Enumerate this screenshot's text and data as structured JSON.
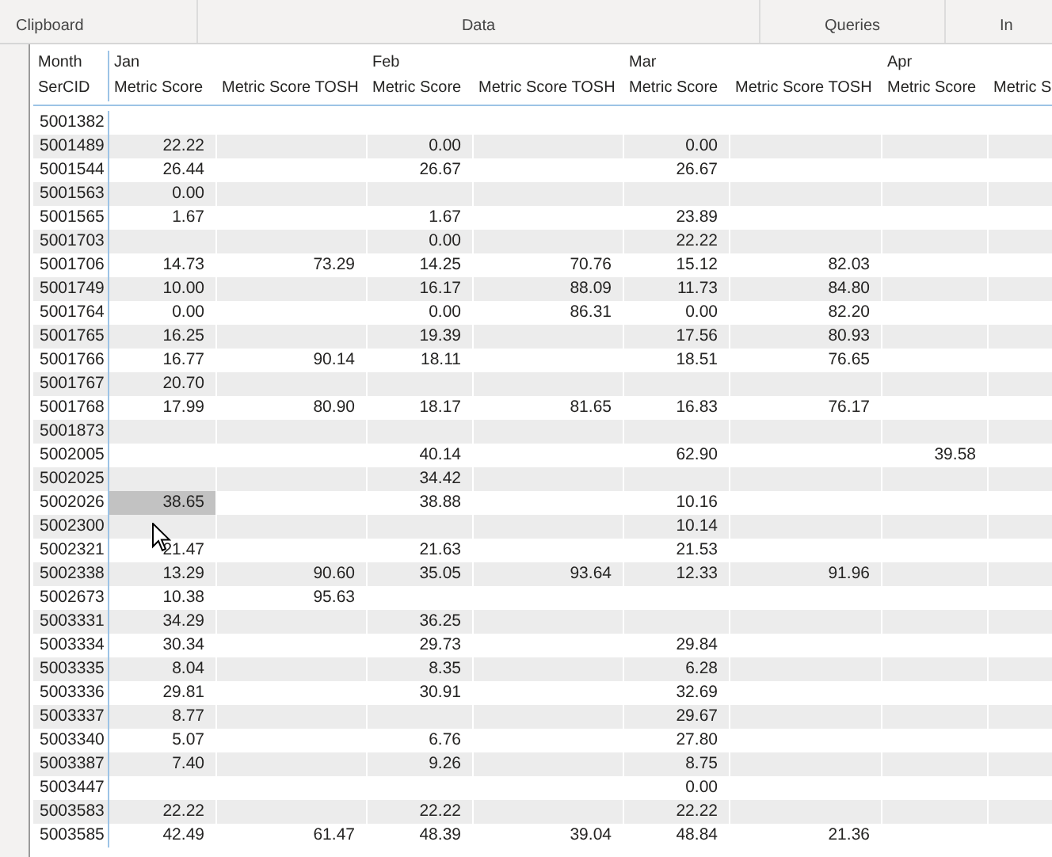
{
  "ribbon": {
    "groups": [
      {
        "label": "Clipboard"
      },
      {
        "label": "Data"
      },
      {
        "label": "Queries"
      },
      {
        "label": "In"
      }
    ]
  },
  "table": {
    "columns": [
      {
        "month": "Month",
        "label": "SerCID"
      },
      {
        "month": "Jan",
        "label": "Metric Score"
      },
      {
        "label": "Metric Score TOSH"
      },
      {
        "month": "Feb",
        "label": "Metric Score"
      },
      {
        "label": "Metric Score TOSH"
      },
      {
        "month": "Mar",
        "label": "Metric Score"
      },
      {
        "label": "Metric Score TOSH"
      },
      {
        "month": "Apr",
        "label": "Metric Score"
      },
      {
        "label": "Metric S"
      }
    ],
    "rows": [
      {
        "cells": [
          {
            "value": "5001382",
            "selected": false
          }
        ]
      },
      {
        "cells": [
          {
            "value": "5001489",
            "selected": false
          },
          {
            "value": "22.22",
            "selected": false
          },
          {
            "selected": false
          },
          {
            "value": "0.00",
            "selected": false
          },
          {
            "selected": false
          },
          {
            "value": "0.00",
            "selected": false
          }
        ]
      },
      {
        "cells": [
          {
            "value": "5001544",
            "selected": false
          },
          {
            "value": "26.44",
            "selected": false
          },
          {
            "selected": false
          },
          {
            "value": "26.67",
            "selected": false
          },
          {
            "selected": false
          },
          {
            "value": "26.67",
            "selected": false
          }
        ]
      },
      {
        "cells": [
          {
            "value": "5001563",
            "selected": false
          },
          {
            "value": "0.00",
            "selected": false
          }
        ]
      },
      {
        "cells": [
          {
            "value": "5001565",
            "selected": false
          },
          {
            "value": "1.67",
            "selected": false
          },
          {
            "selected": false
          },
          {
            "value": "1.67",
            "selected": false
          },
          {
            "selected": false
          },
          {
            "value": "23.89",
            "selected": false
          }
        ]
      },
      {
        "cells": [
          {
            "value": "5001703",
            "selected": false
          },
          {
            "selected": false
          },
          {
            "selected": false
          },
          {
            "value": "0.00",
            "selected": false
          },
          {
            "selected": false
          },
          {
            "value": "22.22",
            "selected": false
          }
        ]
      },
      {
        "cells": [
          {
            "value": "5001706",
            "selected": false
          },
          {
            "value": "14.73",
            "selected": false
          },
          {
            "value": "73.29",
            "selected": false
          },
          {
            "value": "14.25",
            "selected": false
          },
          {
            "value": "70.76",
            "selected": false
          },
          {
            "value": "15.12",
            "selected": false
          },
          {
            "value": "82.03",
            "selected": false
          }
        ]
      },
      {
        "cells": [
          {
            "value": "5001749",
            "selected": false
          },
          {
            "value": "10.00",
            "selected": false
          },
          {
            "selected": false
          },
          {
            "value": "16.17",
            "selected": false
          },
          {
            "value": "88.09",
            "selected": false
          },
          {
            "value": "11.73",
            "selected": false
          },
          {
            "value": "84.80",
            "selected": false
          }
        ]
      },
      {
        "cells": [
          {
            "value": "5001764",
            "selected": false
          },
          {
            "value": "0.00",
            "selected": false
          },
          {
            "selected": false
          },
          {
            "value": "0.00",
            "selected": false
          },
          {
            "value": "86.31",
            "selected": false
          },
          {
            "value": "0.00",
            "selected": false
          },
          {
            "value": "82.20",
            "selected": false
          }
        ]
      },
      {
        "cells": [
          {
            "value": "5001765",
            "selected": false
          },
          {
            "value": "16.25",
            "selected": false
          },
          {
            "selected": false
          },
          {
            "value": "19.39",
            "selected": false
          },
          {
            "selected": false
          },
          {
            "value": "17.56",
            "selected": false
          },
          {
            "value": "80.93",
            "selected": false
          }
        ]
      },
      {
        "cells": [
          {
            "value": "5001766",
            "selected": false
          },
          {
            "value": "16.77",
            "selected": false
          },
          {
            "value": "90.14",
            "selected": false
          },
          {
            "value": "18.11",
            "selected": false
          },
          {
            "selected": false
          },
          {
            "value": "18.51",
            "selected": false
          },
          {
            "value": "76.65",
            "selected": false
          }
        ]
      },
      {
        "cells": [
          {
            "value": "5001767",
            "selected": false
          },
          {
            "value": "20.70",
            "selected": false
          }
        ]
      },
      {
        "cells": [
          {
            "value": "5001768",
            "selected": false
          },
          {
            "value": "17.99",
            "selected": false
          },
          {
            "value": "80.90",
            "selected": false
          },
          {
            "value": "18.17",
            "selected": false
          },
          {
            "value": "81.65",
            "selected": false
          },
          {
            "value": "16.83",
            "selected": false
          },
          {
            "value": "76.17",
            "selected": false
          }
        ]
      },
      {
        "cells": [
          {
            "value": "5001873",
            "selected": false
          }
        ]
      },
      {
        "cells": [
          {
            "value": "5002005",
            "selected": false
          },
          {
            "selected": false
          },
          {
            "selected": false
          },
          {
            "value": "40.14",
            "selected": false
          },
          {
            "selected": false
          },
          {
            "value": "62.90",
            "selected": false
          },
          {
            "selected": false
          },
          {
            "value": "39.58",
            "selected": false
          }
        ]
      },
      {
        "cells": [
          {
            "value": "5002025",
            "selected": false
          },
          {
            "selected": false
          },
          {
            "selected": false
          },
          {
            "value": "34.42",
            "selected": false
          }
        ]
      },
      {
        "cells": [
          {
            "value": "5002026",
            "selected": false
          },
          {
            "value": "38.65",
            "selected": true
          },
          {
            "selected": false
          },
          {
            "value": "38.88",
            "selected": false
          },
          {
            "selected": false
          },
          {
            "value": "10.16",
            "selected": false
          }
        ]
      },
      {
        "cells": [
          {
            "value": "5002300",
            "selected": false
          },
          {
            "selected": false
          },
          {
            "selected": false
          },
          {
            "selected": false
          },
          {
            "selected": false
          },
          {
            "value": "10.14",
            "selected": false
          }
        ]
      },
      {
        "cells": [
          {
            "value": "5002321",
            "selected": false
          },
          {
            "value": "21.47",
            "selected": false
          },
          {
            "selected": false
          },
          {
            "value": "21.63",
            "selected": false
          },
          {
            "selected": false
          },
          {
            "value": "21.53",
            "selected": false
          }
        ]
      },
      {
        "cells": [
          {
            "value": "5002338",
            "selected": false
          },
          {
            "value": "13.29",
            "selected": false
          },
          {
            "value": "90.60",
            "selected": false
          },
          {
            "value": "35.05",
            "selected": false
          },
          {
            "value": "93.64",
            "selected": false
          },
          {
            "value": "12.33",
            "selected": false
          },
          {
            "value": "91.96",
            "selected": false
          }
        ]
      },
      {
        "cells": [
          {
            "value": "5002673",
            "selected": false
          },
          {
            "value": "10.38",
            "selected": false
          },
          {
            "value": "95.63",
            "selected": false
          }
        ]
      },
      {
        "cells": [
          {
            "value": "5003331",
            "selected": false
          },
          {
            "value": "34.29",
            "selected": false
          },
          {
            "selected": false
          },
          {
            "value": "36.25",
            "selected": false
          }
        ]
      },
      {
        "cells": [
          {
            "value": "5003334",
            "selected": false
          },
          {
            "value": "30.34",
            "selected": false
          },
          {
            "selected": false
          },
          {
            "value": "29.73",
            "selected": false
          },
          {
            "selected": false
          },
          {
            "value": "29.84",
            "selected": false
          }
        ]
      },
      {
        "cells": [
          {
            "value": "5003335",
            "selected": false
          },
          {
            "value": "8.04",
            "selected": false
          },
          {
            "selected": false
          },
          {
            "value": "8.35",
            "selected": false
          },
          {
            "selected": false
          },
          {
            "value": "6.28",
            "selected": false
          }
        ]
      },
      {
        "cells": [
          {
            "value": "5003336",
            "selected": false
          },
          {
            "value": "29.81",
            "selected": false
          },
          {
            "selected": false
          },
          {
            "value": "30.91",
            "selected": false
          },
          {
            "selected": false
          },
          {
            "value": "32.69",
            "selected": false
          }
        ]
      },
      {
        "cells": [
          {
            "value": "5003337",
            "selected": false
          },
          {
            "value": "8.77",
            "selected": false
          },
          {
            "selected": false
          },
          {
            "selected": false
          },
          {
            "selected": false
          },
          {
            "value": "29.67",
            "selected": false
          }
        ]
      },
      {
        "cells": [
          {
            "value": "5003340",
            "selected": false
          },
          {
            "value": "5.07",
            "selected": false
          },
          {
            "selected": false
          },
          {
            "value": "6.76",
            "selected": false
          },
          {
            "selected": false
          },
          {
            "value": "27.80",
            "selected": false
          }
        ]
      },
      {
        "cells": [
          {
            "value": "5003387",
            "selected": false
          },
          {
            "value": "7.40",
            "selected": false
          },
          {
            "selected": false
          },
          {
            "value": "9.26",
            "selected": false
          },
          {
            "selected": false
          },
          {
            "value": "8.75",
            "selected": false
          }
        ]
      },
      {
        "cells": [
          {
            "value": "5003447",
            "selected": false
          },
          {
            "selected": false
          },
          {
            "selected": false
          },
          {
            "selected": false
          },
          {
            "selected": false
          },
          {
            "value": "0.00",
            "selected": false
          }
        ]
      },
      {
        "cells": [
          {
            "value": "5003583",
            "selected": false
          },
          {
            "value": "22.22",
            "selected": false
          },
          {
            "selected": false
          },
          {
            "value": "22.22",
            "selected": false
          },
          {
            "selected": false
          },
          {
            "value": "22.22",
            "selected": false
          }
        ]
      },
      {
        "cells": [
          {
            "value": "5003585",
            "selected": false
          },
          {
            "value": "42.49",
            "selected": false
          },
          {
            "value": "61.47",
            "selected": false
          },
          {
            "value": "48.39",
            "selected": false
          },
          {
            "value": "39.04",
            "selected": false
          },
          {
            "value": "48.84",
            "selected": false
          },
          {
            "value": "21.36",
            "selected": false
          }
        ]
      }
    ]
  }
}
